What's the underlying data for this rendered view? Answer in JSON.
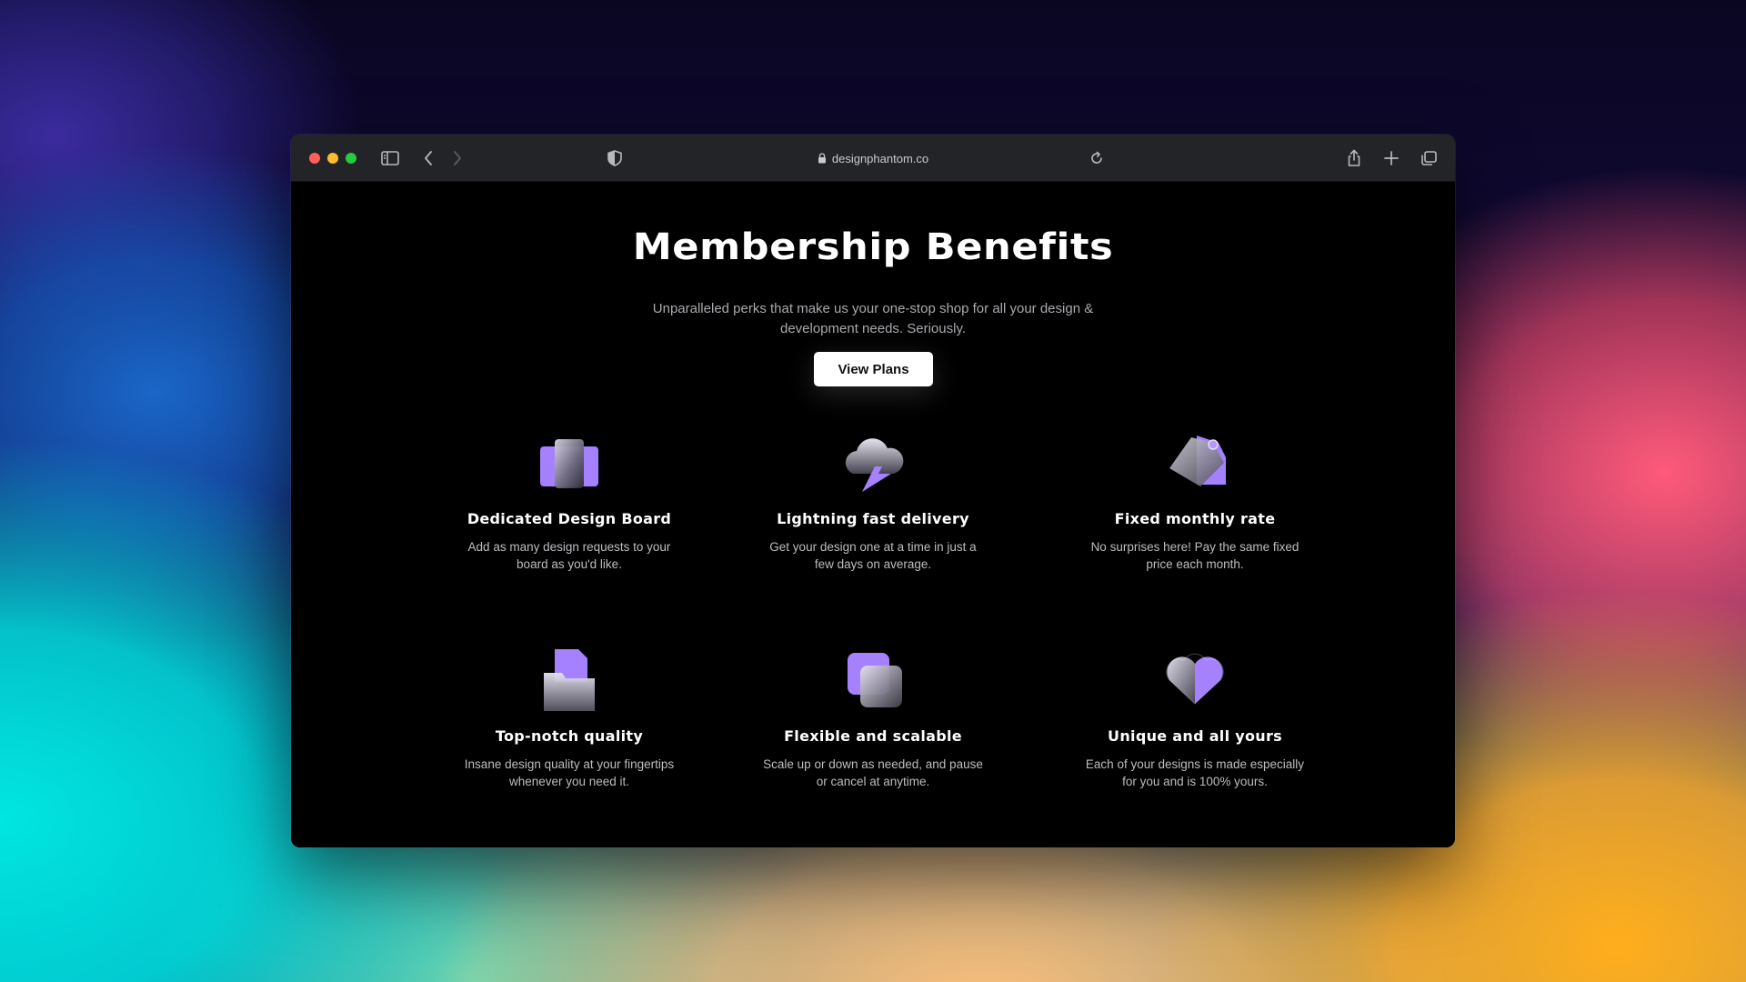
{
  "browser": {
    "url": "designphantom.co",
    "icons": {
      "sidebar": "sidebar-icon",
      "back": "chevron-left-icon",
      "forward": "chevron-right-icon",
      "shield": "shield-icon",
      "lock": "lock-icon",
      "reload": "reload-icon",
      "share": "share-icon",
      "new_tab": "plus-icon",
      "tabs": "tabs-overview-icon"
    }
  },
  "hero": {
    "title": "Membership Benefits",
    "subtitle": "Unparalleled perks that make us your one-stop shop for all your design & development needs. Seriously.",
    "cta_label": "View Plans"
  },
  "features": [
    {
      "title": "Dedicated Design Board",
      "description": "Add as many design requests to your board as you'd like.",
      "icon": "design-board-icon"
    },
    {
      "title": "Lightning fast delivery",
      "description": "Get your design one at a time in just a few days on average.",
      "icon": "cloud-lightning-icon"
    },
    {
      "title": "Fixed monthly rate",
      "description": "No surprises here! Pay the same fixed price each month.",
      "icon": "price-tag-icon"
    },
    {
      "title": "Top-notch quality",
      "description": "Insane design quality at your fingertips whenever you need it.",
      "icon": "folder-icon"
    },
    {
      "title": "Flexible and scalable",
      "description": "Scale up or down as needed, and pause or cancel at anytime.",
      "icon": "layers-icon"
    },
    {
      "title": "Unique and all yours",
      "description": "Each of your designs is made especially for you and is 100% yours.",
      "icon": "heart-icon"
    }
  ],
  "colors": {
    "accent": "#a580ff",
    "page_bg": "#000000",
    "titlebar_bg": "#232427",
    "button_bg": "#ffffff"
  }
}
